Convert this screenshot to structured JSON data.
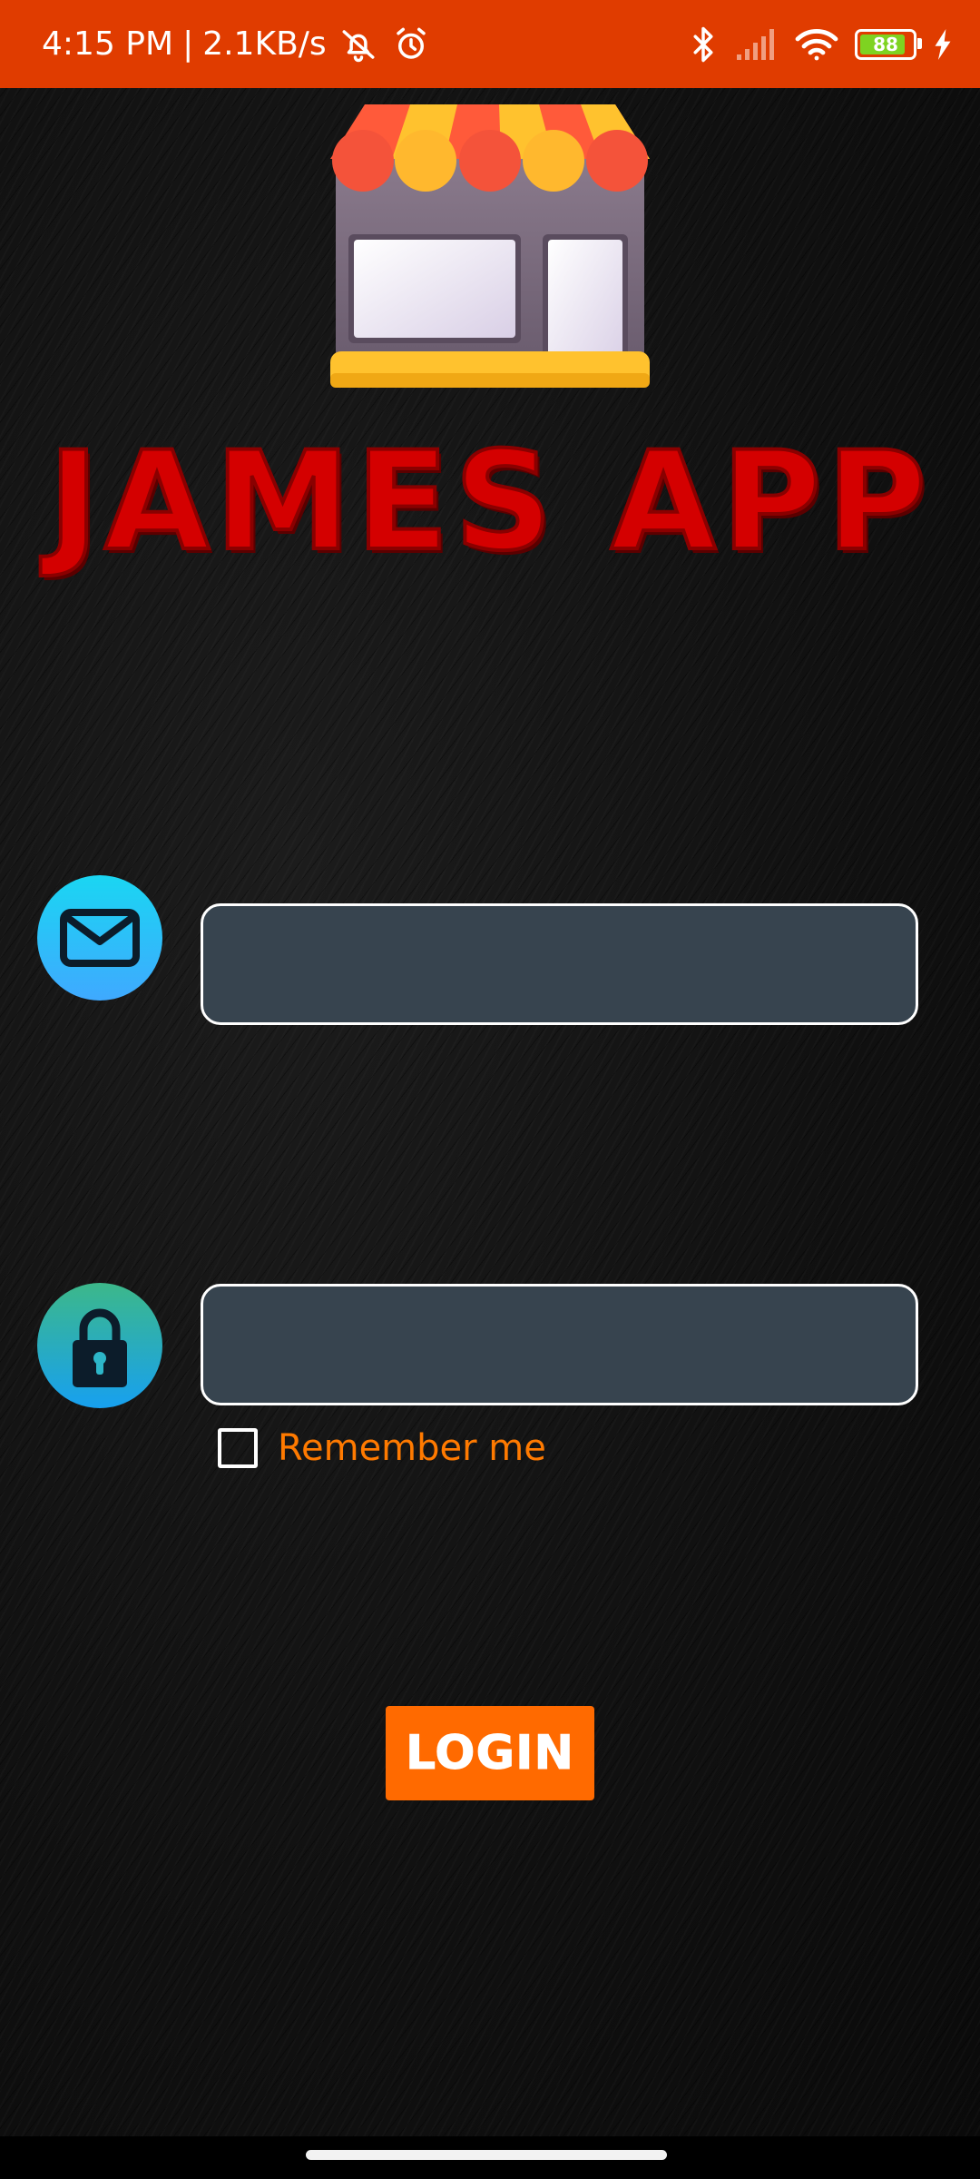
{
  "status_bar": {
    "time": "4:15 PM",
    "separator": "|",
    "network_speed": "2.1KB/s",
    "battery_level": "88",
    "battery_fraction": 0.88,
    "icons": [
      "alarm-off-icon",
      "alarm-icon",
      "bluetooth-icon",
      "signal-icon",
      "wifi-icon",
      "battery-icon",
      "charging-icon"
    ],
    "background_color": "#e03c00"
  },
  "app": {
    "title": "JAMES APP",
    "logo": "storefront-logo",
    "title_color": "#d40000"
  },
  "login_form": {
    "email_icon": "envelope-icon",
    "email_value": "",
    "password_icon": "lock-icon",
    "password_value": "",
    "remember_label": "Remember me",
    "remember_checked": false,
    "login_label": "LOGIN",
    "accent_color": "#ff6a00"
  }
}
